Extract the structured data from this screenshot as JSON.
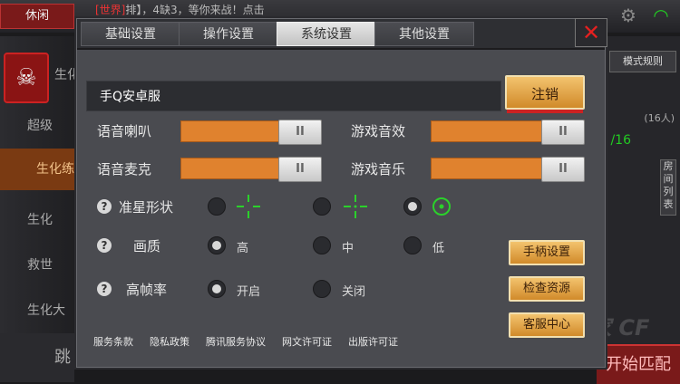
{
  "background": {
    "top_tab": "休闲",
    "chat_channel": "[世界]",
    "chat_text": "排】，4缺3，等你来战！点击",
    "left_items": [
      "生化",
      "超级",
      "生化练",
      "生化",
      "救世",
      "生化大"
    ],
    "bottom_left": "跳",
    "mode_rule": "模式规则",
    "room_info": "(16人)",
    "count": "/16",
    "side_label": "房间列表",
    "start_label": "开始匹配",
    "watermark": "中国玩家 CF"
  },
  "tabs": [
    {
      "label": "基础设置",
      "active": false
    },
    {
      "label": "操作设置",
      "active": false
    },
    {
      "label": "系统设置",
      "active": true
    },
    {
      "label": "其他设置",
      "active": false
    }
  ],
  "close_icon": "close-icon",
  "account": {
    "value": "手Q安卓服",
    "logout_label": "注销"
  },
  "audio": [
    {
      "label": "语音喇叭",
      "level": 0.85
    },
    {
      "label": "游戏音效",
      "level": 0.85
    },
    {
      "label": "语音麦克",
      "level": 0.85
    },
    {
      "label": "游戏音乐",
      "level": 0.85
    }
  ],
  "knob_glyph": "II",
  "crosshair": {
    "label": "准星形状",
    "selected": 2
  },
  "quality": {
    "label": "画质",
    "options": [
      "高",
      "中",
      "低"
    ],
    "selected": 0
  },
  "fps": {
    "label": "高帧率",
    "options": [
      "开启",
      "关闭"
    ],
    "selected": 0
  },
  "help_glyph": "?",
  "side_buttons": [
    "手柄设置",
    "检查资源",
    "客服中心"
  ],
  "links": [
    "服务条款",
    "隐私政策",
    "腾讯服务协议",
    "网文许可证",
    "出版许可证"
  ],
  "colors": {
    "accent": "#e0822e",
    "crosshair": "#2bd12b",
    "close": "#e52020"
  }
}
